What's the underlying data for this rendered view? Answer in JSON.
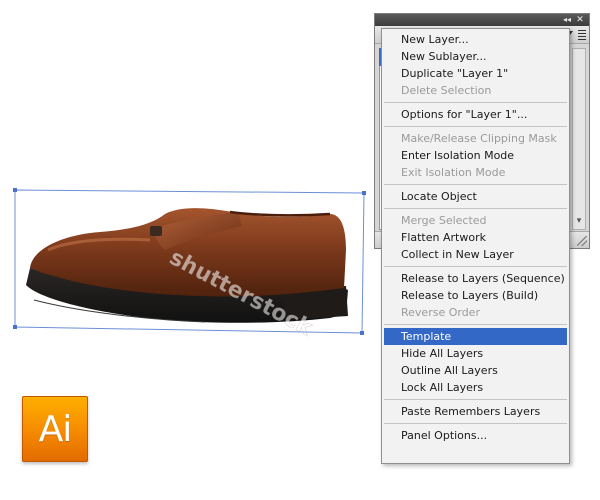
{
  "artwork": {
    "watermark_text": "shutterstock"
  },
  "logo": {
    "text": "Ai",
    "colors": {
      "top": "#ffb000",
      "bottom": "#e36a00",
      "text": "#ffffff"
    }
  },
  "panel": {
    "collapse_icon": "double-chevron-right-icon",
    "close_icon": "close-icon",
    "menu_icon": "panel-menu-icon",
    "selected_layer_color": "#3d6ec9"
  },
  "flyout": {
    "highlight_color": "#3368c6",
    "groups": [
      {
        "items": [
          {
            "label": "New Layer...",
            "enabled": true
          },
          {
            "label": "New Sublayer...",
            "enabled": true
          },
          {
            "label": "Duplicate \"Layer 1\"",
            "enabled": true
          },
          {
            "label": "Delete Selection",
            "enabled": false
          }
        ]
      },
      {
        "items": [
          {
            "label": "Options for \"Layer 1\"...",
            "enabled": true
          }
        ]
      },
      {
        "items": [
          {
            "label": "Make/Release Clipping Mask",
            "enabled": false
          },
          {
            "label": "Enter Isolation Mode",
            "enabled": true
          },
          {
            "label": "Exit Isolation Mode",
            "enabled": false
          }
        ]
      },
      {
        "items": [
          {
            "label": "Locate Object",
            "enabled": true
          }
        ]
      },
      {
        "items": [
          {
            "label": "Merge Selected",
            "enabled": false
          },
          {
            "label": "Flatten Artwork",
            "enabled": true
          },
          {
            "label": "Collect in New Layer",
            "enabled": true
          }
        ]
      },
      {
        "items": [
          {
            "label": "Release to Layers (Sequence)",
            "enabled": true
          },
          {
            "label": "Release to Layers (Build)",
            "enabled": true
          },
          {
            "label": "Reverse Order",
            "enabled": false
          }
        ]
      },
      {
        "items": [
          {
            "label": "Template",
            "enabled": true,
            "highlighted": true
          },
          {
            "label": "Hide All Layers",
            "enabled": true
          },
          {
            "label": "Outline All Layers",
            "enabled": true
          },
          {
            "label": "Lock All Layers",
            "enabled": true
          }
        ]
      },
      {
        "items": [
          {
            "label": "Paste Remembers Layers",
            "enabled": true
          }
        ]
      },
      {
        "items": [
          {
            "label": "Panel Options...",
            "enabled": true
          }
        ]
      }
    ]
  }
}
